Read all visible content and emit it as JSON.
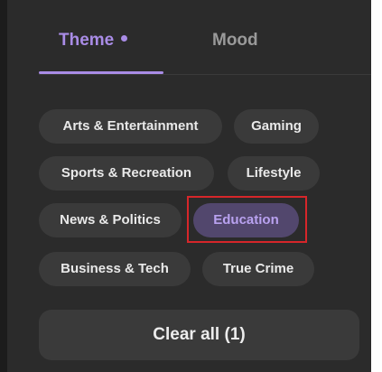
{
  "tabs": {
    "theme": "Theme",
    "mood": "Mood"
  },
  "chips": [
    {
      "label": "Arts & Entertainment",
      "selected": false
    },
    {
      "label": "Gaming",
      "selected": false
    },
    {
      "label": "Sports & Recreation",
      "selected": false
    },
    {
      "label": "Lifestyle",
      "selected": false
    },
    {
      "label": "News & Politics",
      "selected": false
    },
    {
      "label": "Education",
      "selected": true
    },
    {
      "label": "Business & Tech",
      "selected": false
    },
    {
      "label": "True Crime",
      "selected": false
    }
  ],
  "clear_button": "Clear all (1)",
  "colors": {
    "accent": "#a98ce6",
    "panel_bg": "#2b2b2b",
    "chip_bg": "#3a3a3a",
    "selected_chip_bg": "#52476d",
    "highlight": "#d6262a"
  }
}
